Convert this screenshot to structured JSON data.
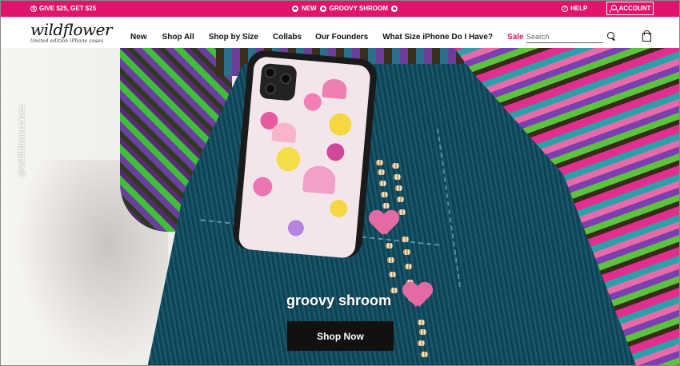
{
  "announcement": {
    "promo": "GIVE $25, GET $25",
    "center": "NEW",
    "center_highlight": "GROOVY SHROOM",
    "help": "HELP",
    "account": "ACCOUNT"
  },
  "brand": {
    "name": "wildflower",
    "tagline": "limited edition iPhone cases"
  },
  "nav": {
    "items": [
      "New",
      "Shop All",
      "Shop by Size",
      "Collabs",
      "Our Founders",
      "What Size iPhone Do I Have?",
      "Sale"
    ]
  },
  "search": {
    "placeholder": "Search"
  },
  "hero": {
    "watermark": "@wildflowercases",
    "title": "groovy shroom",
    "cta": "Shop Now"
  },
  "colors": {
    "brand_pink": "#e0146b",
    "cta_bg": "#111111"
  },
  "icons": [
    "gift-icon",
    "mushroom-icon",
    "help-icon",
    "account-icon",
    "search-icon",
    "bag-icon"
  ]
}
